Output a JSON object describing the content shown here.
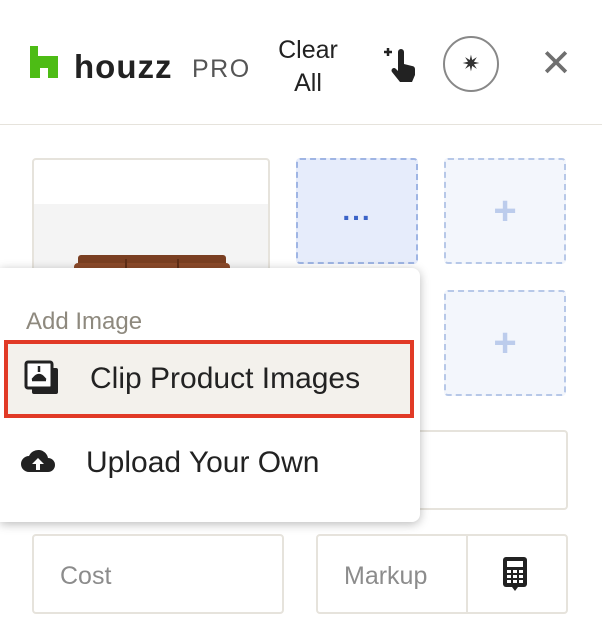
{
  "header": {
    "logo_word": "houzz",
    "logo_pro": "PRO",
    "clear_label": "Clear All",
    "touch_icon": "add-touch-icon",
    "star_icon": "sparkle-icon",
    "close_icon": "close-icon"
  },
  "images": {
    "more_label": "...",
    "add_label": "+"
  },
  "menu": {
    "heading": "Add Image",
    "items": [
      {
        "label": "Clip Product Images",
        "icon": "clip-images-icon"
      },
      {
        "label": "Upload Your Own",
        "icon": "cloud-upload-icon"
      }
    ]
  },
  "fields": {
    "cost_placeholder": "Cost",
    "markup_placeholder": "Markup",
    "calculator_icon": "calculator-icon"
  },
  "colors": {
    "brand": "#4dbc15",
    "highlight_border": "#e13a26",
    "slot_blue": "#3b63c8"
  }
}
